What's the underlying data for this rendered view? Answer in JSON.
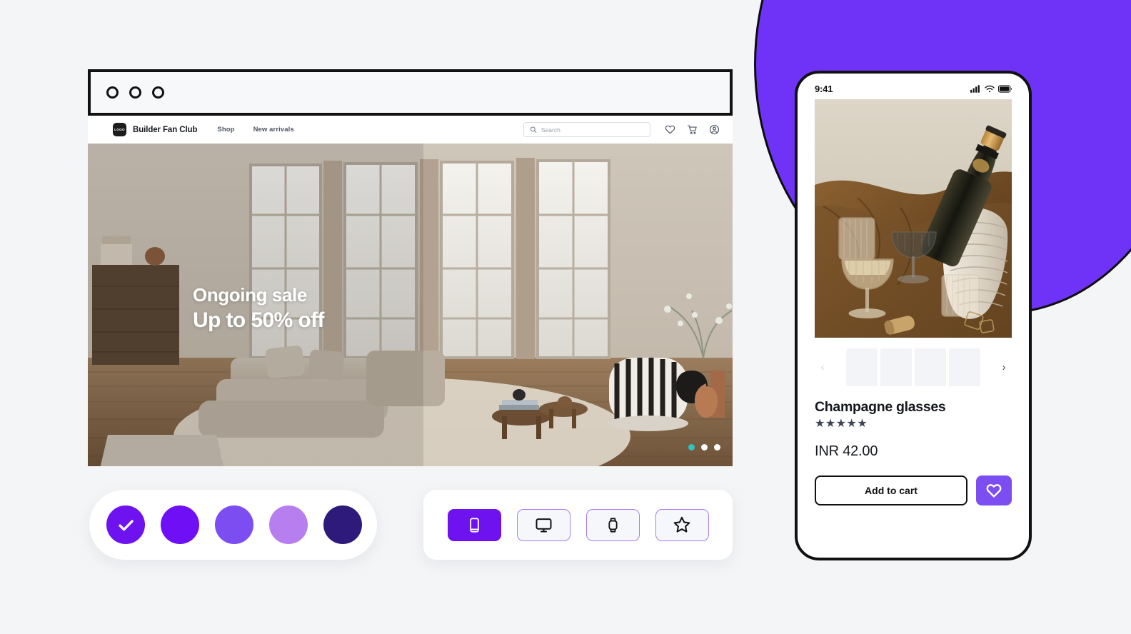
{
  "page": {
    "background_color": "#f4f5f7",
    "accent_color": "#6e33f7"
  },
  "blob": {
    "color": "#6e33f7",
    "outline": "#0d0d0d"
  },
  "browser": {
    "traffic_lights": [
      "circle",
      "circle",
      "circle"
    ],
    "site": {
      "logo_text": "LOGO",
      "brand_name": "Builder Fan Club",
      "nav_links": [
        {
          "label": "Shop"
        },
        {
          "label": "New arrivals"
        }
      ],
      "search": {
        "placeholder": "Search",
        "value": "",
        "icon": "search-icon"
      },
      "icons": [
        {
          "name": "heart-icon"
        },
        {
          "name": "cart-icon"
        },
        {
          "name": "account-icon"
        }
      ]
    },
    "hero": {
      "headline": "Ongoing sale",
      "subheadline": "Up to 50% off",
      "carousel_dots": 3,
      "active_dot_index": 0,
      "active_dot_color": "#2ec4c4",
      "dot_color": "#ffffff",
      "image_alt": "Living room interior with sofa, coffee table and tall windows"
    }
  },
  "swatch_card": {
    "swatches": [
      {
        "color": "#6e12ef",
        "selected": true
      },
      {
        "color": "#6f0ff5",
        "selected": false
      },
      {
        "color": "#7c4df0",
        "selected": false
      },
      {
        "color": "#b77ef0",
        "selected": false
      },
      {
        "color": "#2e1a7a",
        "selected": false
      }
    ],
    "check_icon": "check-icon"
  },
  "device_card": {
    "buttons": [
      {
        "icon": "mobile-icon",
        "label": "Mobile",
        "active": true
      },
      {
        "icon": "desktop-icon",
        "label": "Desktop",
        "active": false
      },
      {
        "icon": "watch-icon",
        "label": "Watch",
        "active": false
      },
      {
        "icon": "star-icon",
        "label": "Favorite",
        "active": false
      }
    ],
    "active_bg": "#6e12ef",
    "border_color": "#a77cf5"
  },
  "phone": {
    "status": {
      "time": "9:41",
      "icons": [
        "cellular-signal-icon",
        "wifi-icon",
        "battery-icon"
      ]
    },
    "product": {
      "image_alt": "Champagne bottle in a ribbed cooler with glasses on brown linen",
      "thumbnails": 4,
      "prev_arrow": "‹",
      "next_arrow": "›",
      "title": "Champagne glasses",
      "rating_stars": "★★★★★",
      "rating_value": 5,
      "price": "INR 42.00",
      "add_to_cart_label": "Add to cart",
      "favorite_icon": "heart-icon",
      "favorite_bg": "#7c4df0"
    }
  }
}
